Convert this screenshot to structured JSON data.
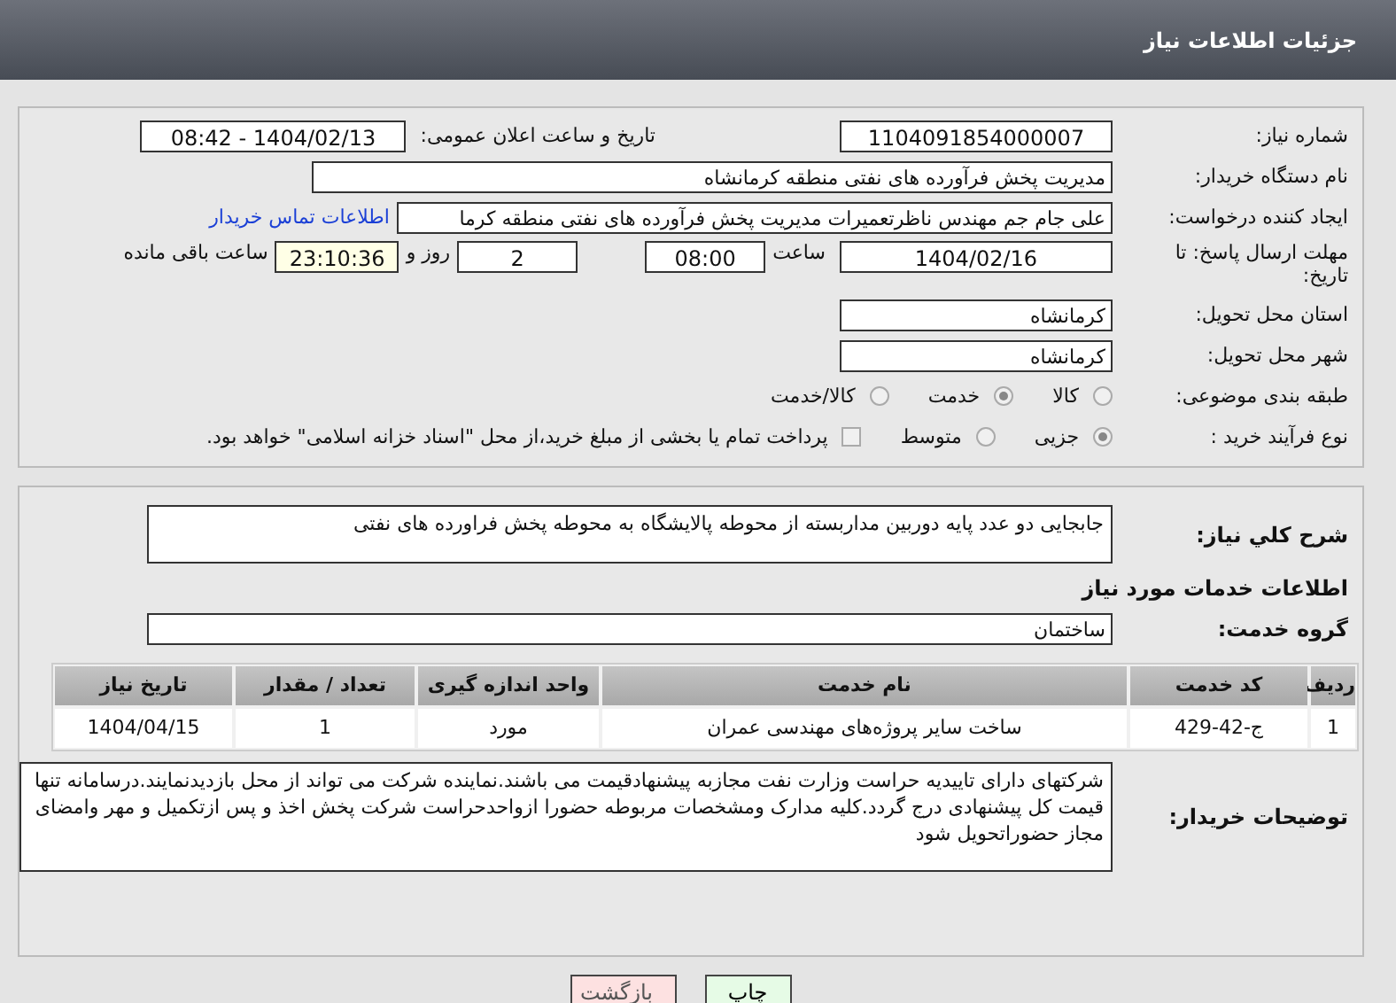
{
  "header": {
    "title": "جزئیات اطلاعات نیاز"
  },
  "need_number": {
    "label": "شماره نیاز:",
    "value": "1104091854000007"
  },
  "announce": {
    "label": "تاریخ و ساعت اعلان عمومی:",
    "value": "1404/02/13 - 08:42"
  },
  "buyer_org": {
    "label": "نام دستگاه خریدار:",
    "value": "مدیریت پخش فرآورده های نفتی منطقه کرمانشاه"
  },
  "requester": {
    "label": "ایجاد کننده درخواست:",
    "value": "علی جام جم مهندس ناظرتعمیرات  مدیریت پخش فرآورده های نفتی منطقه کرما",
    "link": "اطلاعات تماس خریدار"
  },
  "deadline": {
    "label": "مهلت ارسال پاسخ: تا تاریخ:",
    "date": "1404/02/16",
    "time_label": "ساعت",
    "time": "08:00",
    "days": "2",
    "days_label": "روز و",
    "remaining": "23:10:36",
    "remaining_label": "ساعت باقی مانده"
  },
  "province": {
    "label": "استان محل تحویل:",
    "value": "کرمانشاه"
  },
  "city": {
    "label": "شهر محل تحویل:",
    "value": "کرمانشاه"
  },
  "category": {
    "label": "طبقه بندی موضوعی:",
    "options": [
      {
        "label": "کالا",
        "selected": false
      },
      {
        "label": "خدمت",
        "selected": true
      },
      {
        "label": "کالا/خدمت",
        "selected": false
      }
    ]
  },
  "process": {
    "label": "نوع فرآیند خرید :",
    "options": [
      {
        "label": "جزیی",
        "selected": true
      },
      {
        "label": "متوسط",
        "selected": false
      }
    ],
    "payment": {
      "label": "پرداخت تمام یا بخشی از مبلغ خرید،از محل \"اسناد خزانه اسلامی\" خواهد بود.",
      "checked": false
    }
  },
  "description": {
    "label": "شرح کلي نياز:",
    "value": "جابجایی دو عدد پایه دوربین مداربسته از محوطه پالایشگاه به محوطه پخش فراورده های نفتی"
  },
  "services_heading": "اطلاعات خدمات مورد نیاز",
  "service_group": {
    "label": "گروه خدمت:",
    "value": "ساختمان"
  },
  "table": {
    "columns": [
      "ردیف",
      "کد خدمت",
      "نام خدمت",
      "واحد اندازه گیری",
      "تعداد / مقدار",
      "تاریخ نیاز"
    ],
    "rows": [
      [
        "1",
        "ج-42-429",
        "ساخت سایر پروژه‌های مهندسی عمران",
        "مورد",
        "1",
        "1404/04/15"
      ]
    ]
  },
  "buyer_notes": {
    "label": "توضیحات خریدار:",
    "value": "شرکتهای دارای تاییدیه حراست وزارت نفت مجازبه پیشنهادقیمت می باشند.نماینده شرکت می تواند از محل بازدیدنمایند.درسامانه تنها قیمت کل پیشنهادی درج گردد.کلیه مدارک ومشخصات مربوطه حضورا ازواحدحراست شرکت پخش اخذ و پس ازتکمیل و مهر وامضای مجاز حضوراتحویل شود"
  },
  "buttons": [
    {
      "label": "چاپ",
      "kind": "print"
    },
    {
      "label": "بازگشت",
      "kind": "back"
    }
  ]
}
